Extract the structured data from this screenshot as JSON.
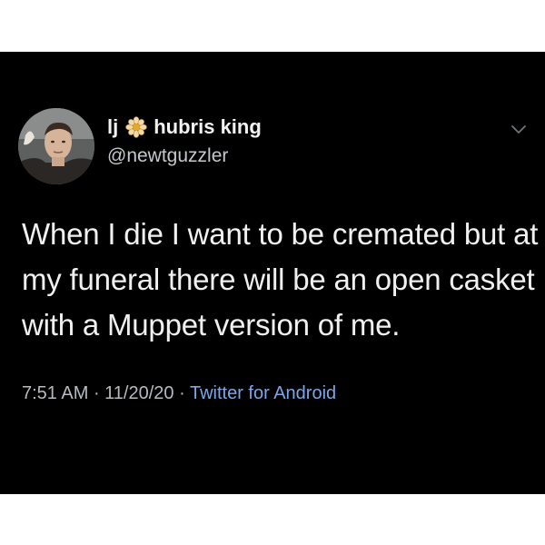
{
  "tweet": {
    "display_name_prefix": "lj",
    "display_name_suffix": "hubris king",
    "handle": "@newtguzzler",
    "text": "When I die I want to be cremated but at my funeral there will be an open casket with a Muppet version of me.",
    "time": "7:51 AM",
    "separator": " · ",
    "date": "11/20/20",
    "source": "Twitter for Android",
    "name_icon": "flower-icon",
    "menu_icon": "chevron-down-icon"
  },
  "colors": {
    "background": "#000000",
    "text": "#f0f0f0",
    "secondary_text": "#b6babe",
    "link": "#7aa7e9"
  }
}
